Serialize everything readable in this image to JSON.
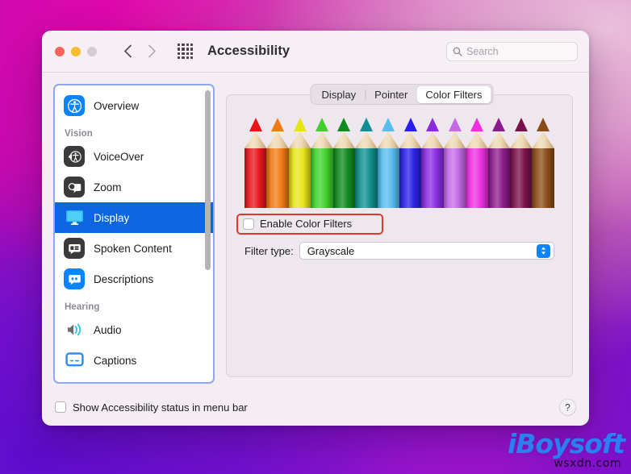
{
  "window": {
    "title": "Accessibility",
    "traffic_lights": [
      "close",
      "minimize",
      "maximize"
    ],
    "back_icon": "chevron-left-icon",
    "forward_icon": "chevron-right-icon",
    "grid_icon": "grid-apps-icon"
  },
  "search": {
    "placeholder": "Search",
    "value": "",
    "icon": "search-icon"
  },
  "sidebar": {
    "items": [
      {
        "type": "item",
        "label": "Overview",
        "icon": "accessibility-person-icon",
        "selected": false
      },
      {
        "type": "header",
        "label": "Vision"
      },
      {
        "type": "item",
        "label": "VoiceOver",
        "icon": "voiceover-icon",
        "selected": false
      },
      {
        "type": "item",
        "label": "Zoom",
        "icon": "zoom-magnifier-icon",
        "selected": false
      },
      {
        "type": "item",
        "label": "Display",
        "icon": "display-monitor-icon",
        "selected": true
      },
      {
        "type": "item",
        "label": "Spoken Content",
        "icon": "speech-bubble-icon",
        "selected": false
      },
      {
        "type": "item",
        "label": "Descriptions",
        "icon": "descriptions-quote-icon",
        "selected": false
      },
      {
        "type": "header",
        "label": "Hearing"
      },
      {
        "type": "item",
        "label": "Audio",
        "icon": "speaker-waves-icon",
        "selected": false
      },
      {
        "type": "item",
        "label": "Captions",
        "icon": "captions-icon",
        "selected": false
      }
    ]
  },
  "tabs": [
    {
      "label": "Display",
      "active": false
    },
    {
      "label": "Pointer",
      "active": false
    },
    {
      "label": "Color Filters",
      "active": true
    }
  ],
  "preview": {
    "name": "colored-pencils-preview",
    "pencil_colors": [
      "#e8141b",
      "#f07a14",
      "#e8e516",
      "#3fd12a",
      "#0f8a1e",
      "#0f8f8f",
      "#56bdee",
      "#2a1fe8",
      "#8a2be2",
      "#c46ae8",
      "#ee2ee0",
      "#8b1a8b",
      "#7a0f4a",
      "#8a4b14"
    ],
    "pencil_tip_colors": [
      "#e8141b",
      "#f07a14",
      "#e8e516",
      "#3fd12a",
      "#0f8a1e",
      "#0f8f8f",
      "#56bdee",
      "#2a1fe8",
      "#8a2be2",
      "#c46ae8",
      "#ee2ee0",
      "#8b1a8b",
      "#7a0f4a",
      "#8a4b14"
    ]
  },
  "controls": {
    "enable_color_filters": {
      "label": "Enable Color Filters",
      "checked": false,
      "highlighted": true,
      "highlight_color": "#e0392c"
    },
    "filter_type": {
      "label": "Filter type:",
      "value": "Grayscale",
      "stepper_icon": "chevron-up-down-icon",
      "accent_color": "#0a84ff"
    }
  },
  "footer": {
    "show_status": {
      "label": "Show Accessibility status in menu bar",
      "checked": false
    },
    "help_label": "?"
  },
  "watermark": {
    "brand": "iBoysoft",
    "site": "wsxdn.com"
  }
}
